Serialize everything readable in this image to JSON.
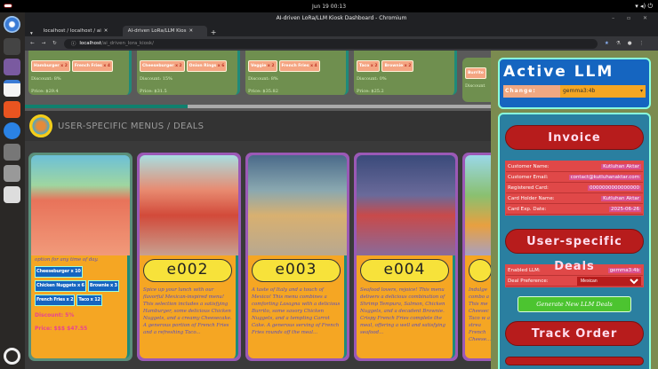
{
  "system": {
    "datetime": "Jun 19  00:13",
    "window_title": "AI-driven LoRa/LLM Kiosk Dashboard - Chromium"
  },
  "browser": {
    "tabs": [
      {
        "label": "localhost / localhost / ai"
      },
      {
        "label": "AI-driven LoRa/LLM Kios"
      }
    ],
    "url_host": "localhost",
    "url_path": "/ai_driven_lora_kiosk/"
  },
  "top_cards": [
    {
      "items": [
        {
          "name": "Hamburger",
          "qty": "x 2"
        },
        {
          "name": "French Fries",
          "qty": "x 4"
        }
      ],
      "discount": "Discount: 8%",
      "price": "Price: $29.4"
    },
    {
      "items": [
        {
          "name": "Cheeseburger",
          "qty": "x 2"
        },
        {
          "name": "Onion Rings",
          "qty": "x 6"
        }
      ],
      "discount": "Discount: 15%",
      "price": "Price: $31.5"
    },
    {
      "items": [
        {
          "name": "Veggie",
          "qty": "x 2"
        },
        {
          "name": "French Fries",
          "qty": "x 4"
        }
      ],
      "discount": "Discount: 8%",
      "price": "Price: $35.82"
    },
    {
      "items": [
        {
          "name": "Taco",
          "qty": "x 2"
        },
        {
          "name": "Brownie",
          "qty": "x 2"
        }
      ],
      "discount": "Discount: 0%",
      "price": "Price: $25.2"
    },
    {
      "items": [
        {
          "name": "Burrito",
          "qty": ""
        }
      ],
      "discount": "Discount",
      "price": ""
    }
  ],
  "section": {
    "title": "USER-SPECIFIC MENUS / DEALS"
  },
  "menus": [
    {
      "desc_tail": "option for any time of day.",
      "items": [
        {
          "label": "Cheeseburger x 10"
        },
        {
          "label": "Chicken Nuggets x 6"
        },
        {
          "label": "Brownie x 3"
        },
        {
          "label": "French Fries x 2"
        },
        {
          "label": "Taco x 12"
        }
      ],
      "discount": "Discount: 5%",
      "price": "Price: $$$ $47.55"
    },
    {
      "code": "e002",
      "desc": "Spice up your lunch with our flavorful Mexican-inspired menu! This selection includes a satisfying Hamburger, some delicious Chicken Nuggets, and a creamy Cheesecake. A generous portion of French Fries and a refreshing Taco..."
    },
    {
      "code": "e003",
      "desc": "A taste of Italy and a touch of Mexico! This menu combines a comforting Lasagna with a delicious Burrito, some savory Chicken Nuggets, and a tempting Carrot Cake. A generous serving of French Fries rounds off the meal..."
    },
    {
      "code": "e004",
      "desc": "Seafood lovers, rejoice! This menu delivers a delicious combination of Shrimp Tempura, Salmon, Chicken Nuggets, and a decadent Brownie. Crispy French Fries complete the meal, offering a well and satisfying seafood..."
    },
    {
      "code": "",
      "desc": "Indulge combo a This me Cheesec Taco w a strea French Cheese..."
    }
  ],
  "active_llm": {
    "title": "Active LLM",
    "change_label": "Change:",
    "selected": "gemma3:4b"
  },
  "invoice": {
    "title": "Invoice",
    "rows": [
      {
        "label": "Customer Name:",
        "value": "Kutluhan Aktar"
      },
      {
        "label": "Customer Email:",
        "value": "contact@kutluhanaktar.com"
      },
      {
        "label": "Registered Card:",
        "value": "0000000000000000"
      },
      {
        "label": "Card Holder Name:",
        "value": "Kutluhan Aktar"
      },
      {
        "label": "Card Exp. Date:",
        "value": "2025-06-26"
      }
    ]
  },
  "deals": {
    "title": "User-specific Deals",
    "enabled_label": "Enabled LLM:",
    "enabled_value": "gemma3:4b",
    "pref_label": "Deal Preference:",
    "pref_value": "Mexican",
    "generate": "Generate New LLM Deals"
  },
  "track": {
    "title": "Track Order"
  },
  "colors": {
    "purple": "#9b59b6",
    "orange": "#f5a623",
    "red": "#b71c1c",
    "blue": "#1565c0"
  }
}
